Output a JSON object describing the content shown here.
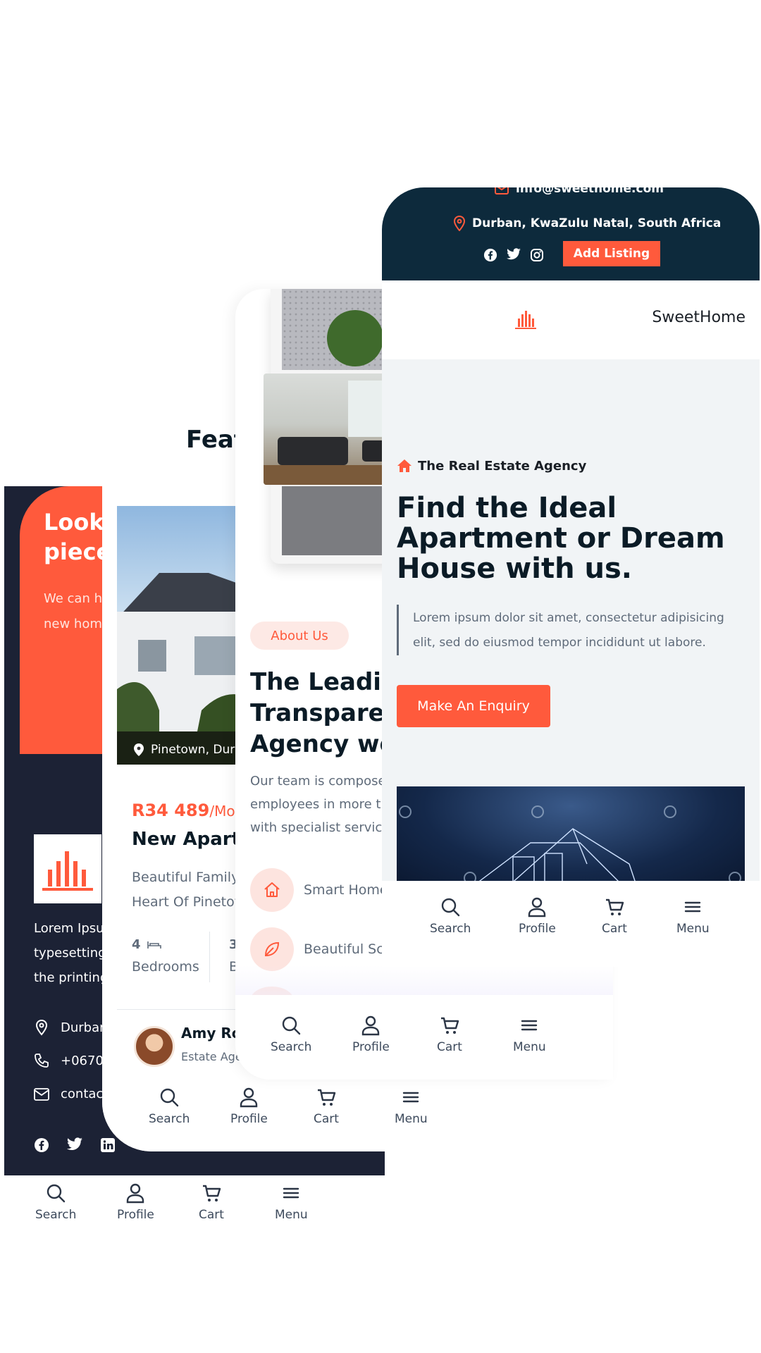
{
  "colors": {
    "accent": "#ff5a3c",
    "navy": "#0d2a3c",
    "dark": "#1c2235",
    "light_bg": "#f1f4f6",
    "text_dark": "#0b1b26",
    "text_grey": "#5f6b7a"
  },
  "nav": {
    "search": "Search",
    "profile": "Profile",
    "cart": "Cart",
    "menu": "Menu"
  },
  "screen1": {
    "hero_title_line1": "Looki",
    "hero_title_line2": "piece",
    "hero_text_line1": "We can h",
    "hero_text_line2": "new hom",
    "footer_text_line1": "Lorem Ipsu",
    "footer_text_line2": "typesetting",
    "footer_text_line3": "the printing",
    "address": "Durbar",
    "phone": "+0670",
    "email": "contac",
    "social_icons": [
      "facebook-icon",
      "twitter-icon",
      "linkedin-icon"
    ]
  },
  "screen2": {
    "section_title": "Feat",
    "location": "Pinetown, Durl",
    "price": "R34 489",
    "price_period": "/Mon",
    "listing_title": "New Apartn",
    "desc_line1": "Beautiful Family",
    "desc_line2": "Heart Of Pinetov",
    "bedrooms_count": "4",
    "bedrooms_label": "Bedrooms",
    "baths_count": "3",
    "baths_label": "B",
    "agent_name": "Amy Rol",
    "agent_role": "Estate Agent"
  },
  "screen3": {
    "badge": "About Us",
    "title_line1": "The Leading",
    "title_line2": "Transparen",
    "title_line3": "Agency wo",
    "text_line1": "Our team is compose",
    "text_line2": "employees in more th",
    "text_line3": "with specialist service",
    "features": [
      "Smart Home",
      "Beautiful Scene Around"
    ]
  },
  "screen4": {
    "email": "info@sweethome.com",
    "address": "Durban, KwaZulu Natal, South Africa",
    "add_listing": "Add Listing",
    "brand": "SweetHome",
    "tagline": "The Real Estate Agency",
    "title_line1": "Find the Ideal",
    "title_line2": "Apartment or Dream",
    "title_line3": "House with us.",
    "intro_line1": "Lorem ipsum dolor sit amet, consectetur adipisicing",
    "intro_line2": "elit, sed do eiusmod tempor incididunt ut labore.",
    "cta": "Make An Enquiry"
  }
}
